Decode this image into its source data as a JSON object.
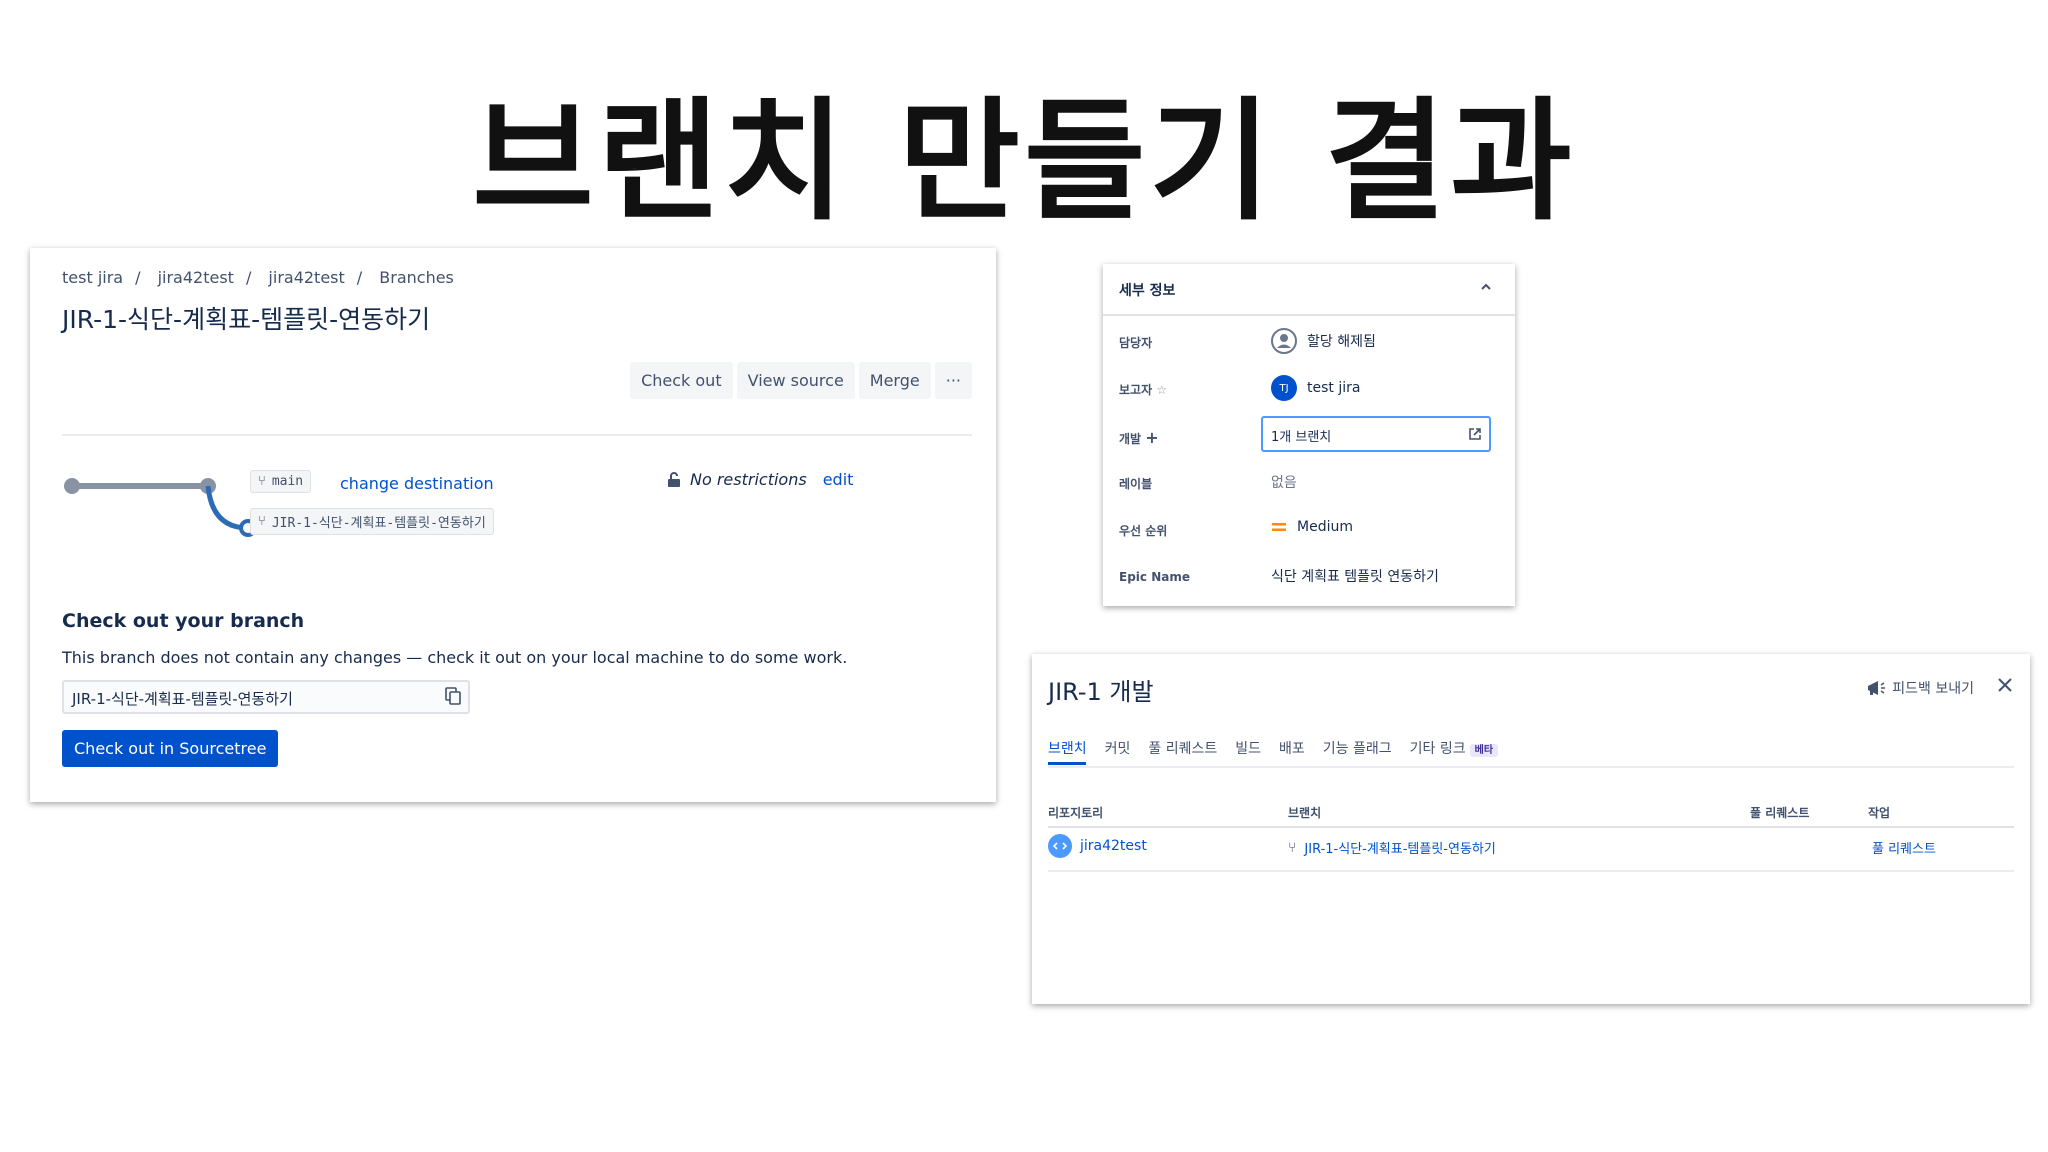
{
  "slide": {
    "title": "브랜치 만들기 결과"
  },
  "bitbucket": {
    "breadcrumb": [
      "test jira",
      "jira42test",
      "jira42test",
      "Branches"
    ],
    "branch_title": "JIR-1-식단-계획표-템플릿-연동하기",
    "buttons": {
      "checkout": "Check out",
      "view_source": "View source",
      "merge": "Merge",
      "more": "···"
    },
    "graph": {
      "target_branch": "main",
      "source_branch": "JIR-1-식단-계획표-템플릿-연동하기",
      "change_destination": "change destination"
    },
    "restrictions": {
      "text": "No restrictions",
      "edit": "edit"
    },
    "checkout_section": {
      "heading": "Check out your branch",
      "description": "This branch does not contain any changes — check it out on your local machine to do some work.",
      "branch_value": "JIR-1-식단-계획표-템플릿-연동하기",
      "sourcetree_button": "Check out in Sourcetree"
    }
  },
  "jira_details": {
    "header": "세부 정보",
    "rows": {
      "assignee": {
        "label": "담당자",
        "value": "할당 해제됨"
      },
      "reporter": {
        "label": "보고자",
        "value": "test jira",
        "initials": "TJ"
      },
      "development": {
        "label": "개발",
        "value": "1개 브랜치"
      },
      "labels": {
        "label": "레이블",
        "value": "없음"
      },
      "priority": {
        "label": "우선 순위",
        "value": "Medium"
      },
      "epic": {
        "label": "Epic Name",
        "value": "식단 계획표 템플릿 연동하기"
      }
    }
  },
  "jira_dev_dialog": {
    "title": "JIR-1 개발",
    "feedback": "피드백 보내기",
    "tabs": [
      "브랜치",
      "커밋",
      "풀 리퀘스트",
      "빌드",
      "배포",
      "기능 플래그",
      "기타 링크"
    ],
    "beta_badge": "베타",
    "columns": {
      "repository": "리포지토리",
      "branch": "브랜치",
      "pull_request": "풀 리퀘스트",
      "action": "작업"
    },
    "row": {
      "repository": "jira42test",
      "branch": "JIR-1-식단-계획표-템플릿-연동하기",
      "action": "풀 리퀘스트"
    }
  },
  "colors": {
    "primary": "#0052cc",
    "graph_gray": "#8993a4",
    "graph_blue": "#2d6bb5",
    "priority_medium": "#ff8b00"
  }
}
